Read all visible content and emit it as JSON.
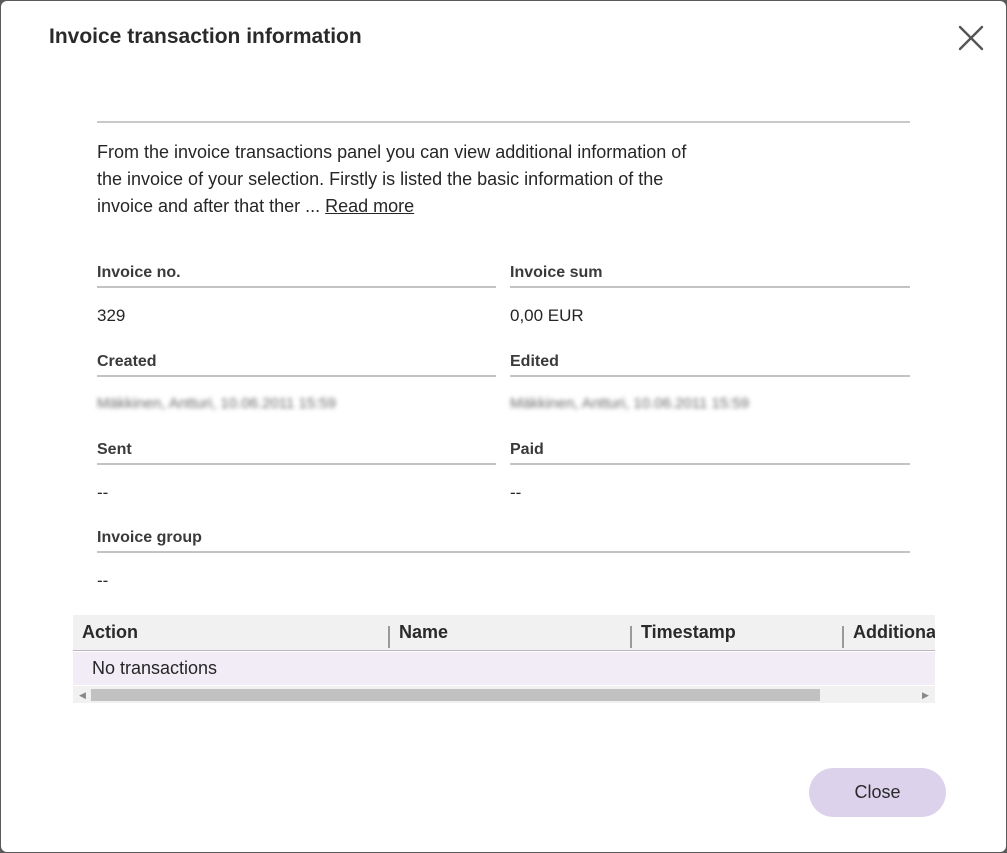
{
  "dialog": {
    "title": "Invoice transaction information",
    "close_icon": "close-icon",
    "intro_text": "From the invoice transactions panel you can view additional information of the invoice of your selection. Firstly is listed the basic information of the invoice and after that ther ... ",
    "read_more_label": "Read more"
  },
  "fields": {
    "invoice_no": {
      "label": "Invoice no.",
      "value": "329"
    },
    "invoice_sum": {
      "label": "Invoice sum",
      "value": "0,00 EUR"
    },
    "created": {
      "label": "Created",
      "value": "Mäkkinen, Antturi, 10.06.2011 15:59"
    },
    "edited": {
      "label": "Edited",
      "value": "Mäkkinen, Antturi, 10.06.2011 15:59"
    },
    "sent": {
      "label": "Sent",
      "value": "--"
    },
    "paid": {
      "label": "Paid",
      "value": "--"
    },
    "invoice_group": {
      "label": "Invoice group",
      "value": "--"
    }
  },
  "table": {
    "columns": [
      "Action",
      "Name",
      "Timestamp",
      "Additional"
    ],
    "empty_message": "No transactions"
  },
  "footer": {
    "close_label": "Close"
  },
  "colors": {
    "accent": "#dcd2ec",
    "row_highlight": "#f2ecf7"
  }
}
